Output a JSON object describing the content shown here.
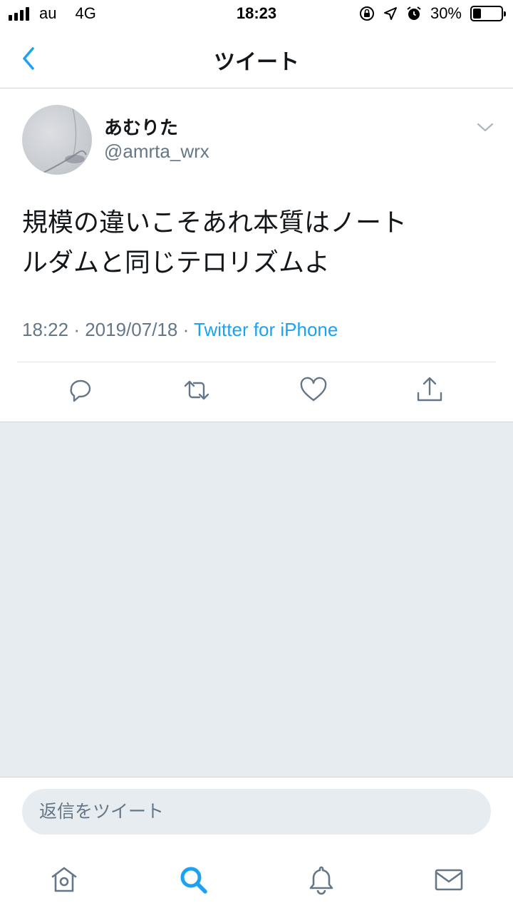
{
  "status_bar": {
    "carrier": "au",
    "network": "4G",
    "time": "18:23",
    "battery": "30%",
    "battery_level": 0.3,
    "icons": [
      "signal-icon",
      "rotation-lock-icon",
      "location-icon",
      "alarm-icon",
      "battery-icon"
    ]
  },
  "nav": {
    "title": "ツイート",
    "back_icon": "chevron-left-icon"
  },
  "tweet": {
    "display_name": "あむりた",
    "handle": "@amrta_wrx",
    "text_line1": "規模の違いこそあれ本質はノート",
    "text_line2": "ルダムと同じテロリズムよ",
    "time": "18:22",
    "separator": "·",
    "date": "2019/07/18",
    "source": "Twitter for iPhone",
    "actions": [
      "reply-icon",
      "retweet-icon",
      "like-icon",
      "share-icon"
    ]
  },
  "reply": {
    "placeholder": "返信をツイート"
  },
  "tabs": [
    "home-icon",
    "search-icon",
    "notifications-icon",
    "messages-icon"
  ],
  "colors": {
    "accent": "#1da1f2",
    "secondary_text": "#657786",
    "background_gray": "#e6ecf0",
    "icon_gray": "#657786"
  }
}
